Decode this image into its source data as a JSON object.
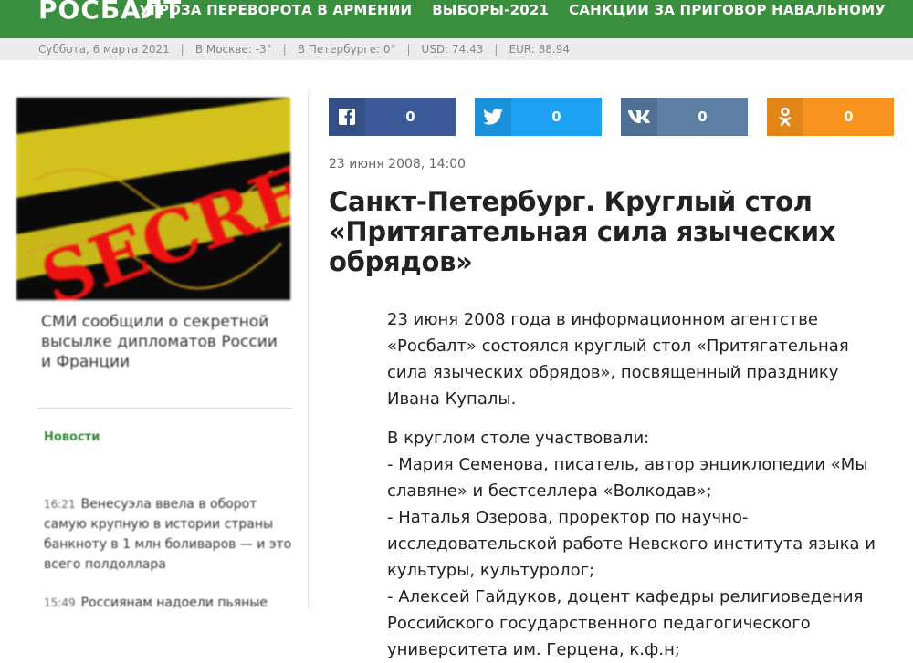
{
  "header": {
    "logo": "РОСБАЛТ",
    "nav": [
      "УГРОЗА ПЕРЕВОРОТА В АРМЕНИИ",
      "ВЫБОРЫ-2021",
      "САНКЦИИ ЗА ПРИГОВОР НАВАЛЬНОМУ"
    ]
  },
  "infobar": {
    "date": "Суббота, 6 марта 2021",
    "moscow": "В Москве: -3°",
    "spb": "В Петербурге: 0°",
    "usd": "USD: 74.43",
    "eur": "EUR: 88.94"
  },
  "sidebar": {
    "image_text": "SECRET",
    "caption": "СМИ сообщили о секретной высылке дипломатов России и Франции",
    "news_heading": "Новости",
    "news": [
      {
        "time": "16:21",
        "text": "Венесуэла ввела в оборот самую крупную в истории страны банкноту в 1 млн боливаров — и это всего полдоллара"
      },
      {
        "time": "15:49",
        "text": "Россиянам надоели пьяные"
      }
    ]
  },
  "share": {
    "buttons": [
      {
        "name": "facebook",
        "count": "0",
        "color": "#3b5998",
        "icon_bg": "#344e86"
      },
      {
        "name": "twitter",
        "count": "0",
        "color": "#1da1f2",
        "icon_bg": "#1a91da"
      },
      {
        "name": "vk",
        "count": "0",
        "color": "#5d7fa4",
        "icon_bg": "#4f6f93"
      },
      {
        "name": "odnoklassniki",
        "count": "0",
        "color": "#f7931e",
        "icon_bg": "#e3861a"
      }
    ]
  },
  "article": {
    "date": "23 июня 2008, 14:00",
    "title": "Санкт-Петербург. Круглый стол «Притягательная сила языческих обрядов»",
    "intro": "23 июня 2008 года в информационном агентстве «Росбалт» состоялся круглый стол «Притягательная сила языческих обрядов», посвященный  празднику  Ивана Купалы.",
    "participants_heading": "В круглом столе участвовали:",
    "participants": [
      "- Мария  Семенова, писатель, автор энциклопедии «Мы славяне» и бестселлера «Волкодав»;",
      "- Наталья  Озерова, проректор по научно-исследовательской работе Невского института языка и культуры, культуролог;",
      "- Алексей Гайдуков, доцент кафедры религиоведения Российского государственного педагогического университета им. Герцена, к.ф.н;"
    ]
  }
}
